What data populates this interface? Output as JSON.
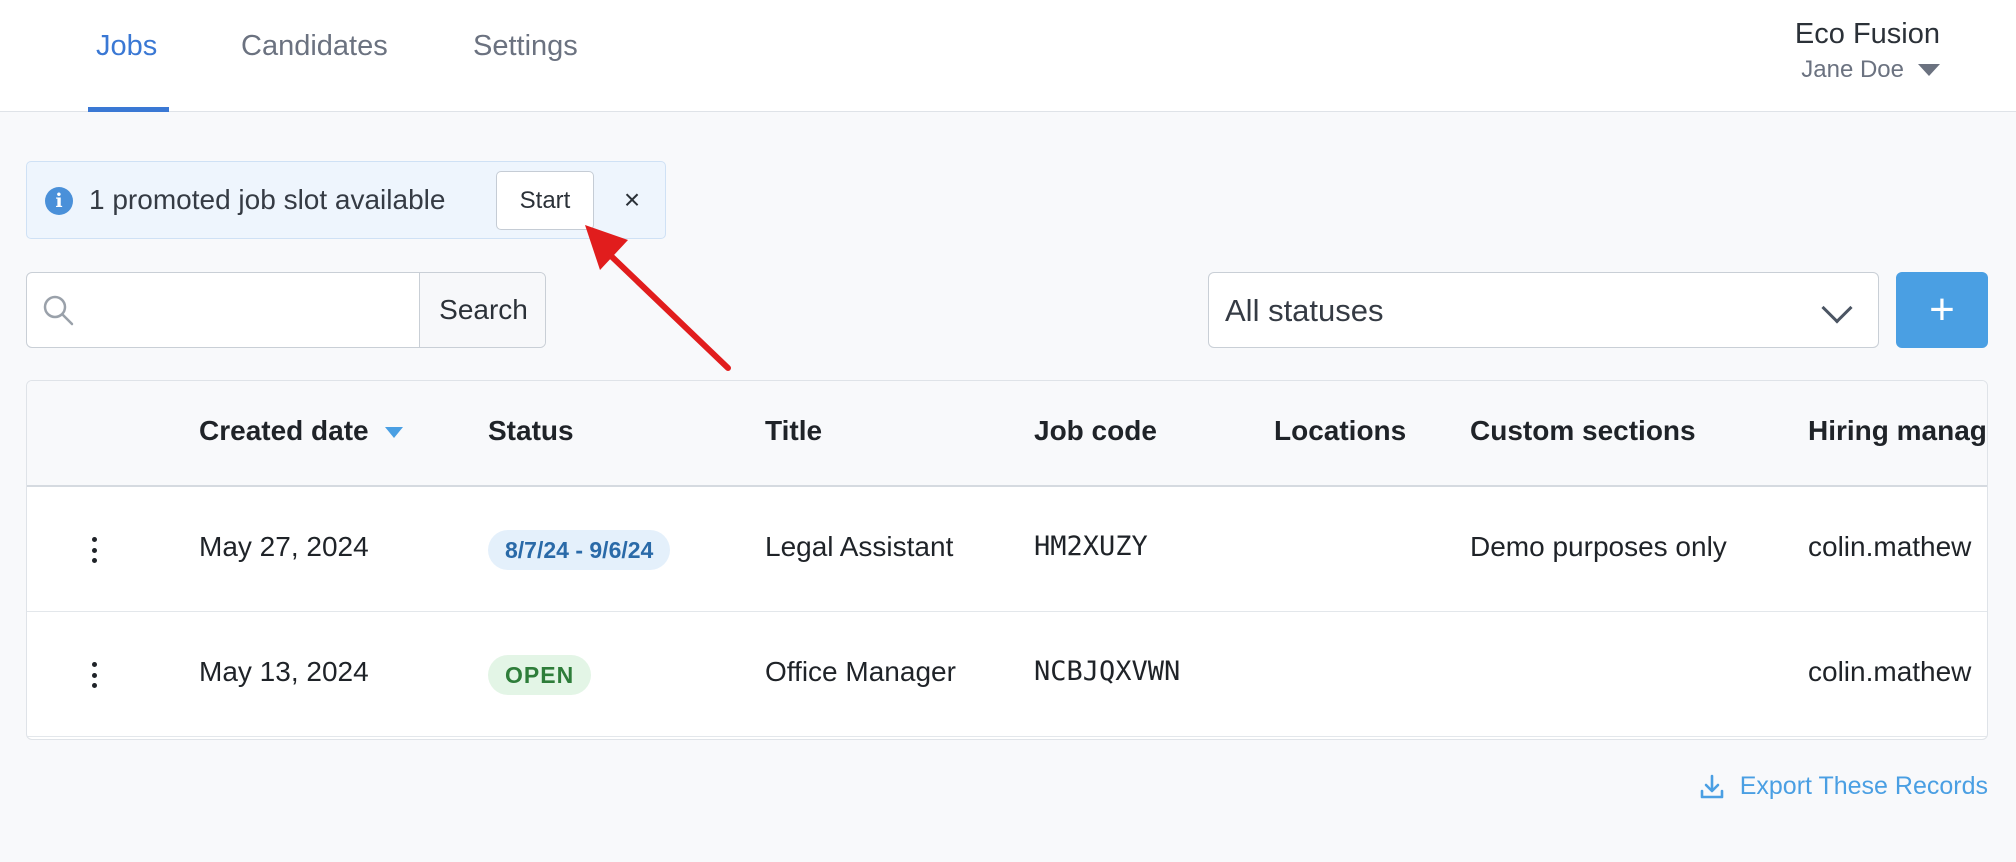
{
  "nav": {
    "tabs": [
      {
        "label": "Jobs",
        "active": true
      },
      {
        "label": "Candidates",
        "active": false
      },
      {
        "label": "Settings",
        "active": false
      }
    ],
    "org_name": "Eco Fusion",
    "user_name": "Jane Doe"
  },
  "promo": {
    "message": "1 promoted job slot available",
    "start_label": "Start",
    "close_label": "×",
    "icon": "info-icon"
  },
  "search": {
    "value": "",
    "placeholder": "",
    "button_label": "Search",
    "icon": "search-icon"
  },
  "filters": {
    "status_selected": "All statuses",
    "add_label": "+"
  },
  "table": {
    "columns": [
      "",
      "Created date",
      "Status",
      "Title",
      "Job code",
      "Locations",
      "Custom sections",
      "Hiring manag"
    ],
    "sort_column": "Created date",
    "rows": [
      {
        "created": "May 27, 2024",
        "status": "8/7/24 - 9/6/24",
        "status_type": "date-range",
        "title": "Legal Assistant",
        "job_code": "HM2XUZY",
        "locations": "",
        "custom_sections": "Demo purposes only",
        "hiring_manager": "colin.mathew"
      },
      {
        "created": "May 13, 2024",
        "status": "OPEN",
        "status_type": "open",
        "title": "Office Manager",
        "job_code": "NCBJQXVWN",
        "locations": "",
        "custom_sections": "",
        "hiring_manager": "colin.mathew"
      }
    ]
  },
  "footer": {
    "export_label": "Export These Records",
    "icon": "download-icon"
  },
  "colors": {
    "accent": "#3a78d4",
    "primary_button": "#4a9fe3",
    "annotation_arrow": "#e11d1d",
    "badge_open_bg": "#e3f5e6",
    "badge_date_bg": "#e4f0fb"
  }
}
